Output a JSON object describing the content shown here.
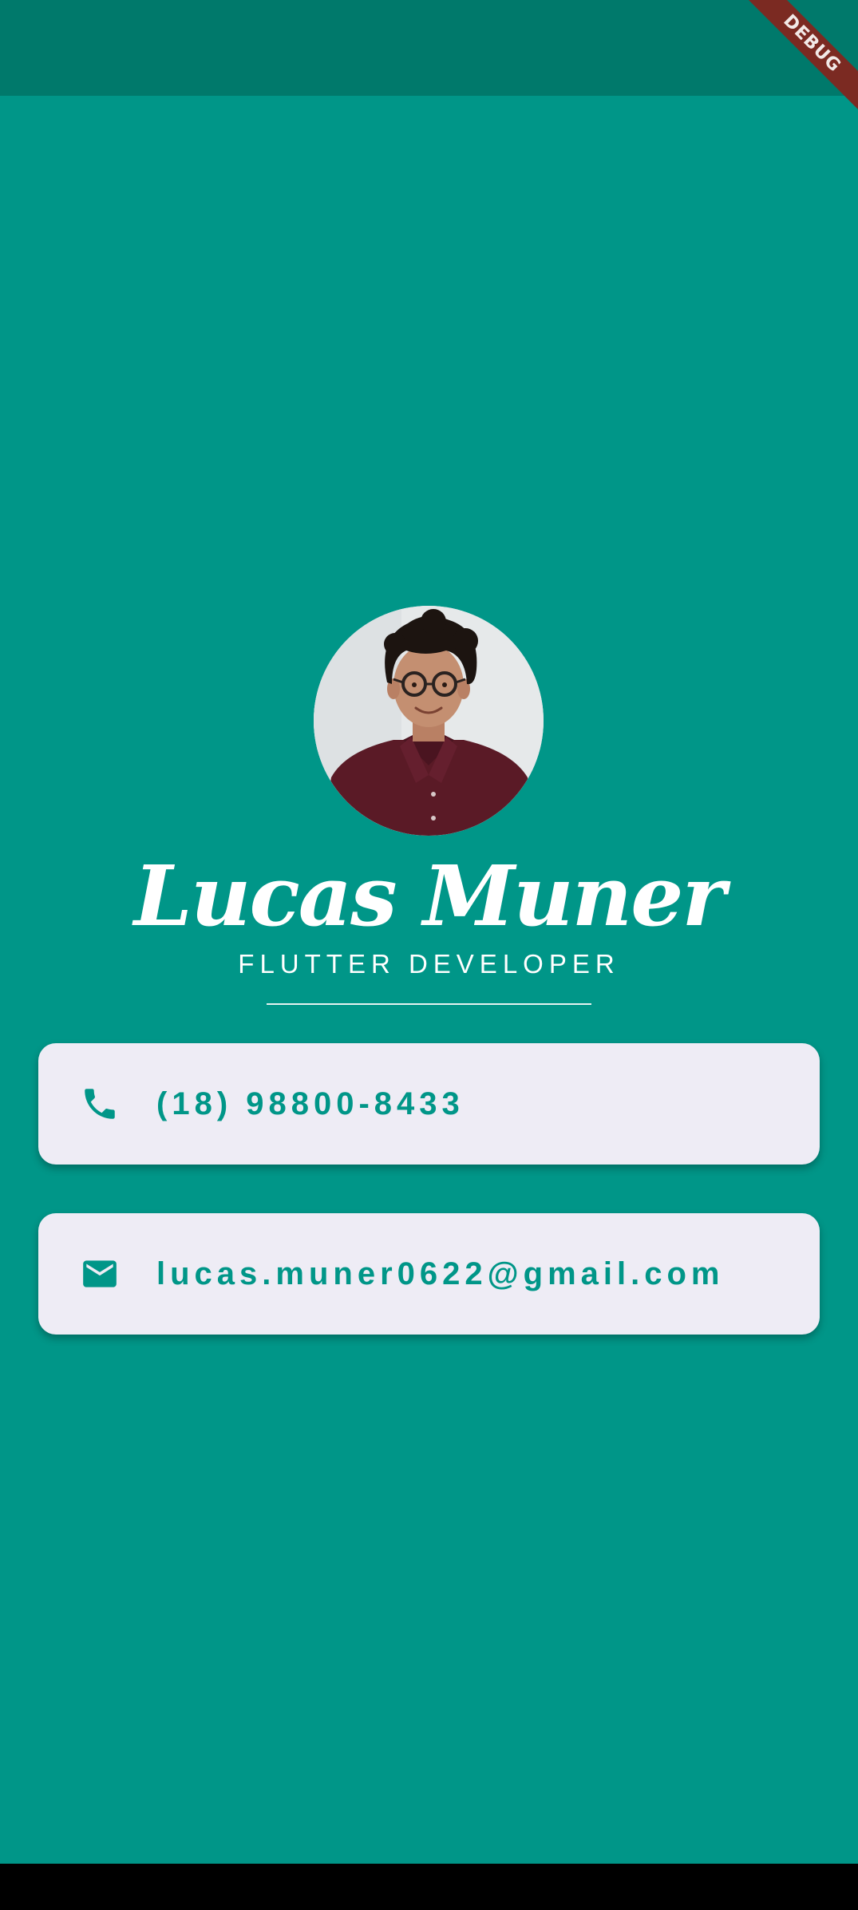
{
  "app": {
    "background_color": "#009688",
    "status_bar_color": "#00796b",
    "debug_banner": "DEBUG"
  },
  "profile": {
    "photo_icon": "profile-photo",
    "name": "Lucas Muner",
    "role": "FLUTTER DEVELOPER"
  },
  "contacts": {
    "phone": {
      "icon": "phone-icon",
      "value": "(18) 98800-8433"
    },
    "email": {
      "icon": "mail-icon",
      "value": "lucas.muner0622@gmail.com"
    }
  },
  "colors": {
    "accent": "#009688",
    "card": "#eeecf5",
    "text_light": "#ffffff"
  }
}
